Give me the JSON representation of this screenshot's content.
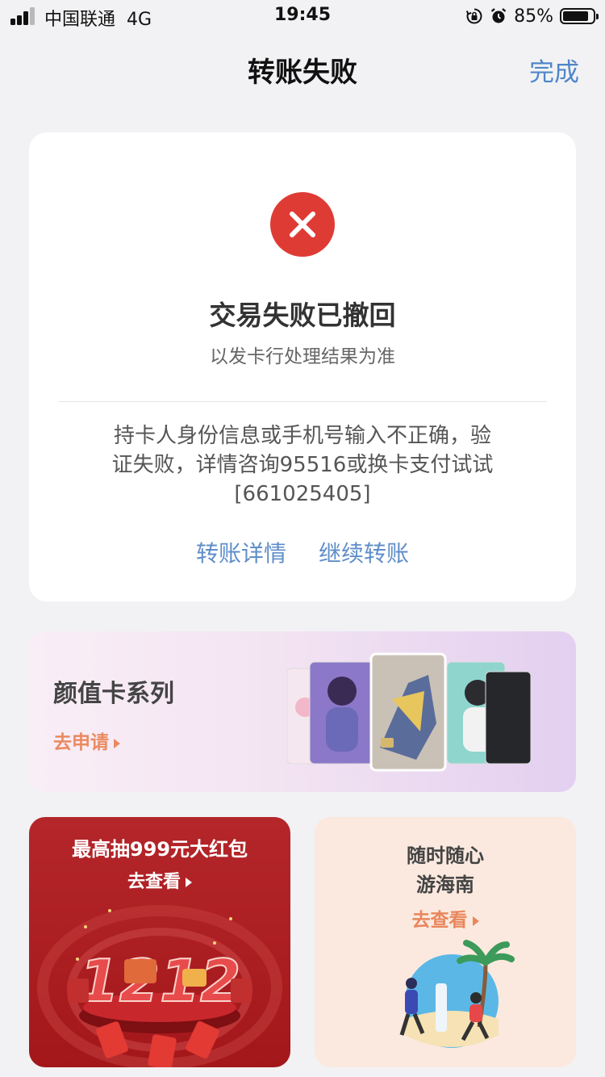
{
  "status_bar": {
    "carrier": "中国联通",
    "network": "4G",
    "time": "19:45",
    "battery": "85%",
    "battery_level": 0.85
  },
  "nav": {
    "title": "转账失败",
    "done_label": "完成"
  },
  "result": {
    "icon": "close-icon",
    "title": "交易失败已撤回",
    "subtitle": "以发卡行处理结果为准",
    "message": "持卡人身份信息或手机号输入不正确，验证失败，详情咨询95516或换卡支付试试[661025405]",
    "actions": [
      "转账详情",
      "继续转账"
    ]
  },
  "banner": {
    "title": "颜值卡系列",
    "cta": "去申请"
  },
  "promos": {
    "left": {
      "title": "最高抽999元大红包",
      "cta": "去查看",
      "art_text": "1212"
    },
    "right": {
      "title_line1": "随时随心",
      "title_line2": "游海南",
      "cta": "去查看"
    }
  },
  "colors": {
    "accent_blue": "#5f8ec9",
    "error_red": "#df3b35",
    "orange_cta": "#ea8a60",
    "promo_red": "#a3171b"
  }
}
